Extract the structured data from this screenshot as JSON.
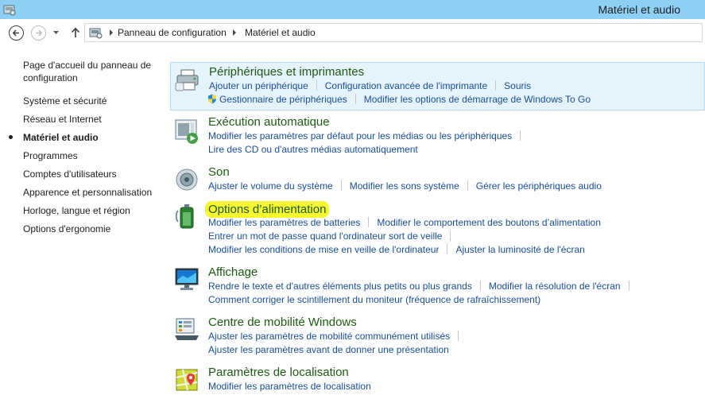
{
  "window": {
    "title": "Matériel et audio"
  },
  "breadcrumb": {
    "root": "Panneau de configuration",
    "current": "Matériel et audio"
  },
  "sidebar": {
    "home": "Page d'accueil du panneau de configuration",
    "items": [
      {
        "label": "Système et sécurité",
        "active": false
      },
      {
        "label": "Réseau et Internet",
        "active": false
      },
      {
        "label": "Matériel et audio",
        "active": true
      },
      {
        "label": "Programmes",
        "active": false
      },
      {
        "label": "Comptes d'utilisateurs",
        "active": false
      },
      {
        "label": "Apparence et personnalisation",
        "active": false
      },
      {
        "label": "Horloge, langue et région",
        "active": false
      },
      {
        "label": "Options d'ergonomie",
        "active": false
      }
    ]
  },
  "sections": [
    {
      "title": "Périphériques et imprimantes",
      "icon": "printer-icon",
      "lines": [
        [
          "Ajouter un périphérique",
          "Configuration avancée de l'imprimante",
          "Souris"
        ],
        [
          "Gestionnaire de périphériques",
          "Modifier les options de démarrage de Windows To Go"
        ]
      ]
    },
    {
      "title": "Exécution automatique",
      "icon": "autoplay-icon",
      "lines": [
        [
          "Modifier les paramètres par défaut pour les médias ou les périphériques"
        ],
        [
          "Lire des CD ou d'autres médias automatiquement"
        ]
      ]
    },
    {
      "title": "Son",
      "icon": "speaker-icon",
      "lines": [
        [
          "Ajuster le volume du système",
          "Modifier les sons système",
          "Gérer les périphériques audio"
        ]
      ]
    },
    {
      "title": "Options d’alimentation",
      "icon": "battery-icon",
      "lines": [
        [
          "Modifier les paramètres de batteries",
          "Modifier le comportement des boutons d’alimentation"
        ],
        [
          "Entrer un mot de passe quand l'ordinateur sort de veille"
        ],
        [
          "Modifier les conditions de mise en veille de l'ordinateur",
          "Ajuster la luminosité de l'écran"
        ]
      ]
    },
    {
      "title": "Affichage",
      "icon": "monitor-icon",
      "lines": [
        [
          "Rendre le texte et d'autres éléments plus petits ou plus grands",
          "Modifier la résolution de l'écran"
        ],
        [
          "Comment corriger le scintillement du moniteur (fréquence de rafraîchissement)"
        ]
      ]
    },
    {
      "title": "Centre de mobilité Windows",
      "icon": "mobility-center-icon",
      "lines": [
        [
          "Ajuster les paramètres de mobilité communément utilisés"
        ],
        [
          "Ajuster les paramètres avant de donner une présentation"
        ]
      ]
    },
    {
      "title": "Paramètres de localisation",
      "icon": "location-icon",
      "lines": [
        [
          "Modifier les paramètres de localisation"
        ]
      ]
    }
  ],
  "colors": {
    "titlebar": "#8dd0f4",
    "link": "#1a4ea0",
    "section_title": "#1e5a12",
    "hover_bg": "#e5f3fb",
    "highlight": "#f6f631"
  }
}
